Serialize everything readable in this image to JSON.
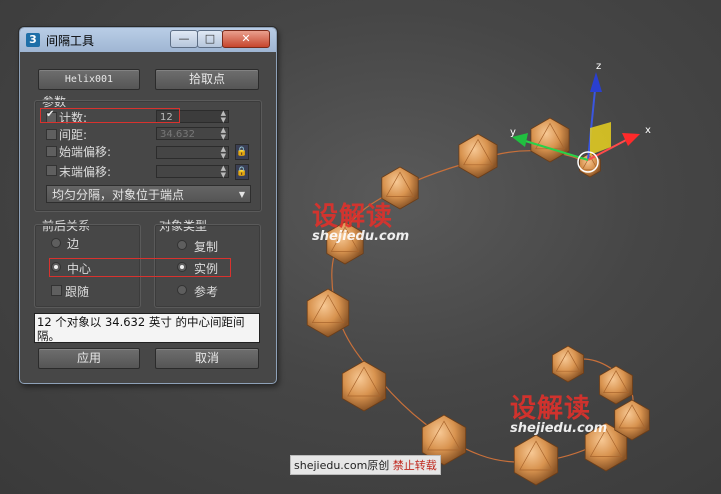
{
  "dialog": {
    "title": "间隔工具",
    "app_icon_text": "3",
    "window_buttons": {
      "minimize": "—",
      "maximize": "□",
      "close": "✕"
    },
    "path_button": "Helix001",
    "pick_points_button": "拾取点",
    "params_header": "参数",
    "count": {
      "label": "计数:",
      "value": "12",
      "checked": true
    },
    "spacing": {
      "label": "间距:",
      "value": "34.632",
      "checked": false
    },
    "start_offset": {
      "label": "始端偏移:",
      "value": "",
      "checked": false
    },
    "end_offset": {
      "label": "末端偏移:",
      "value": "",
      "checked": false
    },
    "distribution_dropdown": "均匀分隔，对象位于端点",
    "context_group": {
      "title": "前后关系",
      "options": [
        "边",
        "中心"
      ],
      "selected": "中心",
      "follow": {
        "label": "跟随",
        "checked": false
      }
    },
    "object_type_group": {
      "title": "对象类型",
      "options": [
        "复制",
        "实例",
        "参考"
      ],
      "selected": "实例"
    },
    "status_text": "12 个对象以 34.632 英寸 的中心间距间隔。",
    "apply_button": "应用",
    "cancel_button": "取消"
  },
  "viewport": {
    "gizmo_labels": {
      "x": "x",
      "y": "y",
      "z": "z"
    },
    "object_count": 13
  },
  "watermarks": {
    "logo_cn": "设解读",
    "logo_en": "shejiedu.com",
    "footer_site": "shejiedu.com",
    "footer_mid": "原创",
    "footer_red": "禁止转载"
  },
  "colors": {
    "object_fill": "#d8934f",
    "path_line": "#c8703a",
    "dialog_bg": "#474747",
    "highlight_box": "#d9322e"
  }
}
